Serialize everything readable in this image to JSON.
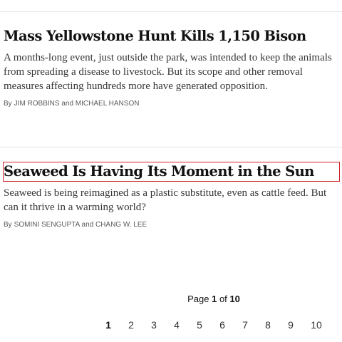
{
  "articles": [
    {
      "headline": "Mass Yellowstone Hunt Kills 1,150 Bison",
      "summary": "A months-long event, just outside the park, was intended to keep the animals from spreading a disease to livestock. But its scope and other removal measures affecting hundreds more have generated opposition.",
      "byline_prefix": "By",
      "authors": "JIM ROBBINS and MICHAEL HANSON"
    },
    {
      "headline": "Seaweed Is Having Its Moment in the Sun",
      "summary": "Seaweed is being reimagined as a plastic substitute, even as cattle feed. But can it thrive in a warming world?",
      "byline_prefix": "By",
      "authors": "SOMINI SENGUPTA and CHANG W. LEE"
    }
  ],
  "pagination": {
    "label": "Page",
    "current": "1",
    "of": "of",
    "total": "10",
    "pages": [
      "1",
      "2",
      "3",
      "4",
      "5",
      "6",
      "7",
      "8",
      "9",
      "10"
    ]
  },
  "colors": {
    "focus_outline": "#d0262b",
    "headline": "#121212",
    "summary": "#363636",
    "byline": "#5a5a5a",
    "divider": "#e2e2e2"
  }
}
